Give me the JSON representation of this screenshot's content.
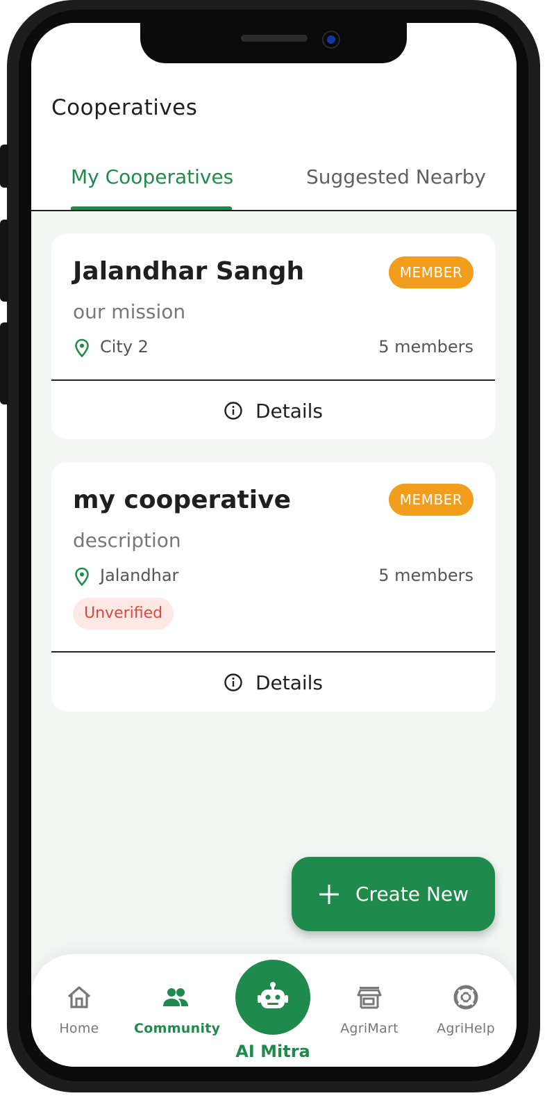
{
  "header": {
    "title": "Cooperatives",
    "tabs": [
      {
        "label": "My Cooperatives",
        "active": true
      },
      {
        "label": "Suggested Nearby",
        "active": false
      }
    ]
  },
  "cooperatives": [
    {
      "name": "Jalandhar Sangh",
      "badge": "MEMBER",
      "description": "our mission",
      "location": "City 2",
      "members": "5 members",
      "status": "",
      "details_label": "Details"
    },
    {
      "name": "my cooperative",
      "badge": "MEMBER",
      "description": "description",
      "location": "Jalandhar",
      "members": "5 members",
      "status": "Unverified",
      "details_label": "Details"
    }
  ],
  "fab": {
    "label": "Create New",
    "icon": "plus-icon"
  },
  "bottom_nav": {
    "items": [
      {
        "label": "Home",
        "icon": "home-icon",
        "active": false
      },
      {
        "label": "Community",
        "icon": "people-icon",
        "active": true
      },
      {
        "label": "AI Mitra",
        "icon": "robot-icon",
        "active": false
      },
      {
        "label": "AgriMart",
        "icon": "store-icon",
        "active": false
      },
      {
        "label": "AgriHelp",
        "icon": "lifebuoy-icon",
        "active": false
      }
    ]
  },
  "colors": {
    "primary": "#1f8a4c",
    "badge": "#f29d1c",
    "unverified_text": "#d84a3a",
    "unverified_bg": "#fde8e6",
    "background": "#f2f7f4"
  }
}
